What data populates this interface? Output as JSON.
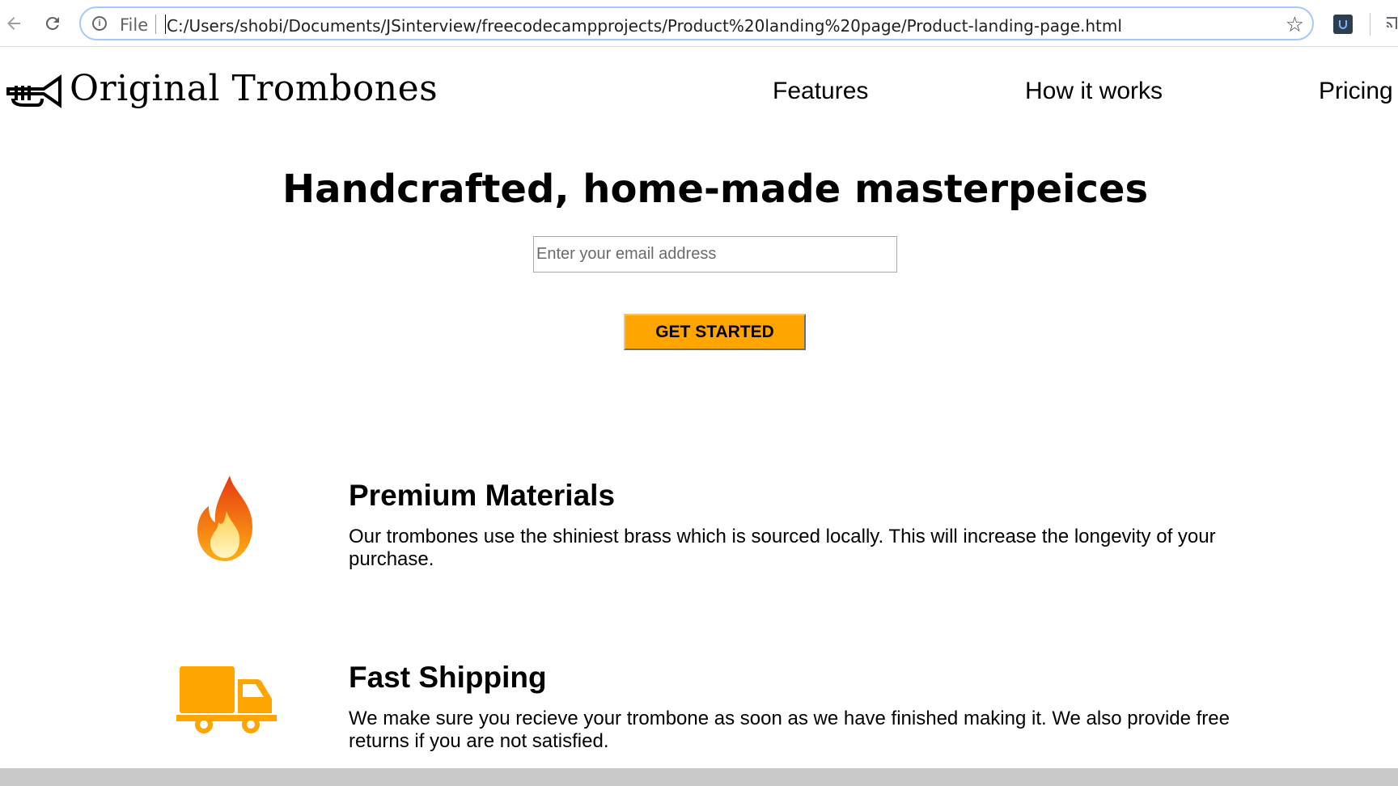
{
  "browser": {
    "file_label": "File",
    "url": "C:/Users/shobi/Documents/JSinterview/freecodecampprojects/Product%20landing%20page/Product-landing-page.html",
    "icons": [
      "back-arrow-icon",
      "reload-icon",
      "info-icon",
      "star-icon",
      "extension-icon",
      "cast-icon"
    ]
  },
  "header": {
    "logo_text": "Original Trombones",
    "logo_icon": "trumpet-icon",
    "nav": [
      {
        "label": "Features"
      },
      {
        "label": "How it works"
      },
      {
        "label": "Pricing"
      }
    ]
  },
  "hero": {
    "title": "Handcrafted, home-made masterpeices",
    "email_placeholder": "Enter your email address",
    "email_value": "",
    "cta_label": "GET STARTED",
    "cta_color": "#ffa500"
  },
  "features": [
    {
      "icon": "fire-icon",
      "title": "Premium Materials",
      "description": "Our trombones use the shiniest brass which is sourced locally. This will increase the longevity of your purchase."
    },
    {
      "icon": "truck-icon",
      "title": "Fast Shipping",
      "description": "We make sure you recieve your trombone as soon as we have finished making it. We also provide free returns if you are not satisfied."
    }
  ],
  "colors": {
    "accent": "#ffa500",
    "omnibox_border": "#a8c7fa",
    "text": "#000000"
  }
}
